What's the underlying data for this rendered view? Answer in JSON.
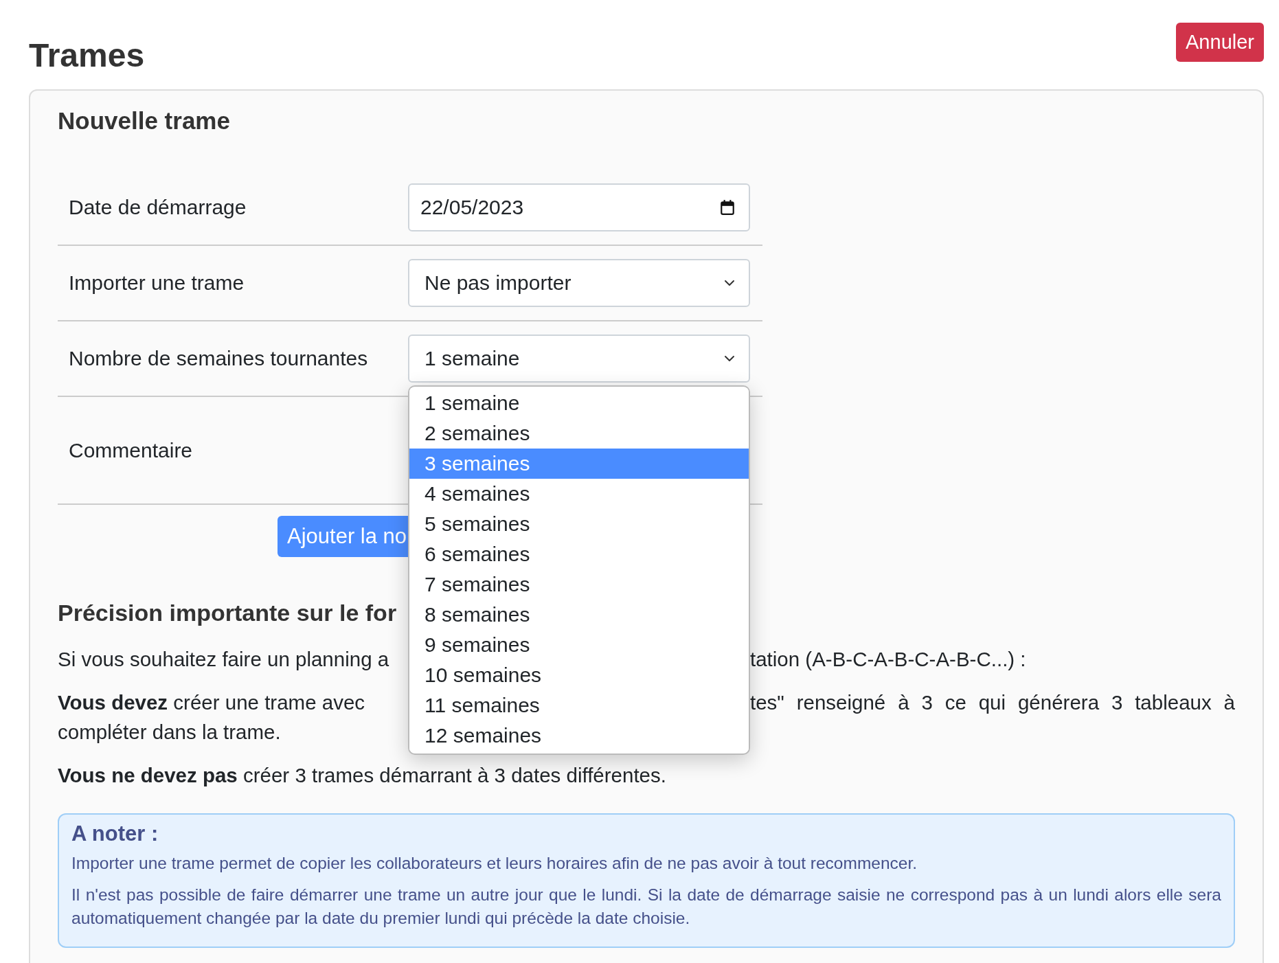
{
  "page": {
    "title": "Trames",
    "cancel_button": "Annuler"
  },
  "card": {
    "title": "Nouvelle trame"
  },
  "form": {
    "rows": [
      {
        "kind": "date",
        "label": "Date de démarrage",
        "value": "22/05/2023"
      },
      {
        "kind": "select",
        "label": "Importer une trame",
        "value": "Ne pas importer"
      },
      {
        "kind": "select",
        "label": "Nombre de semaines tournantes",
        "value": "1 semaine",
        "expanded": true,
        "options": [
          {
            "label": "1 semaine",
            "highlighted": false
          },
          {
            "label": "2 semaines",
            "highlighted": false
          },
          {
            "label": "3 semaines",
            "highlighted": true
          },
          {
            "label": "4 semaines",
            "highlighted": false
          },
          {
            "label": "5 semaines",
            "highlighted": false
          },
          {
            "label": "6 semaines",
            "highlighted": false
          },
          {
            "label": "7 semaines",
            "highlighted": false
          },
          {
            "label": "8 semaines",
            "highlighted": false
          },
          {
            "label": "9 semaines",
            "highlighted": false
          },
          {
            "label": "10 semaines",
            "highlighted": false
          },
          {
            "label": "11 semaines",
            "highlighted": false
          },
          {
            "label": "12 semaines",
            "highlighted": false
          }
        ]
      },
      {
        "kind": "textarea",
        "label": "Commentaire"
      }
    ],
    "submit_button": "Ajouter la no"
  },
  "info": {
    "title": "Précision importante sur le for",
    "paragraphs": [
      {
        "left": "Si vous souhaitez faire un planning a",
        "right": "tation (A-B-C-A-B-C-A-B-C...) :"
      },
      {
        "left": "**Vous devez** créer une trame avec",
        "right": "tes\" renseigné à 3 ce qui générera 3 tableaux à",
        "continuation": "compléter dans la trame."
      },
      {
        "text": "**Vous ne devez pas** créer 3 trames démarrant à 3 dates différentes."
      }
    ]
  },
  "note": {
    "title": "A noter :",
    "lines": [
      "Importer une trame permet de copier les collaborateurs et leurs horaires afin de ne pas avoir à tout recommencer.",
      "Il n'est pas possible de faire démarrer une trame un autre jour que le lundi. Si la date de démarrage saisie ne correspond pas à un lundi alors elle sera automatiquement changée par la date du premier lundi qui précède la date choisie."
    ]
  }
}
